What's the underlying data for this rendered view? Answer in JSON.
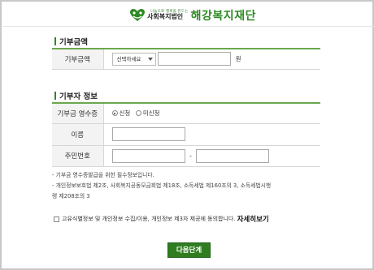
{
  "header": {
    "small_text": "나눔으로 행복을 만드는",
    "org_type": "사회복지법인",
    "org_name": "해강복지재단"
  },
  "donation_amount": {
    "section_title": "기부금액",
    "row_label": "기부금액",
    "select_value": "선택하세요",
    "amount_value": "",
    "unit": "원"
  },
  "donor_info": {
    "section_title": "기부자 정보",
    "receipt_label": "기부금 영수증",
    "receipt_options": [
      {
        "label": "신청",
        "checked": true
      },
      {
        "label": "미신청",
        "checked": false
      }
    ],
    "name_label": "이름",
    "name_value": "",
    "rrn_label": "주민번호",
    "rrn_part1": "",
    "rrn_separator": "-",
    "rrn_part2": ""
  },
  "notes": [
    "- 기부금 영수증발급을 위한 필수정보입니다.",
    "- 개인정보보호법 제2조, 사회복지공동모금회법 제18조, 소득세법 제160조의 3, 소득세법시행",
    "령 제208조의 3"
  ],
  "agreement": {
    "text": "고유식별정보 및 개인정보 수집/이용, 개인정보 제3자 제공에 동의합니다.",
    "link": "자세히보기",
    "checked": false
  },
  "next_button": "다음단계",
  "colors": {
    "accent": "#2e8a24",
    "button": "#2f7d1f",
    "table_border_top": "#6aa84f"
  }
}
